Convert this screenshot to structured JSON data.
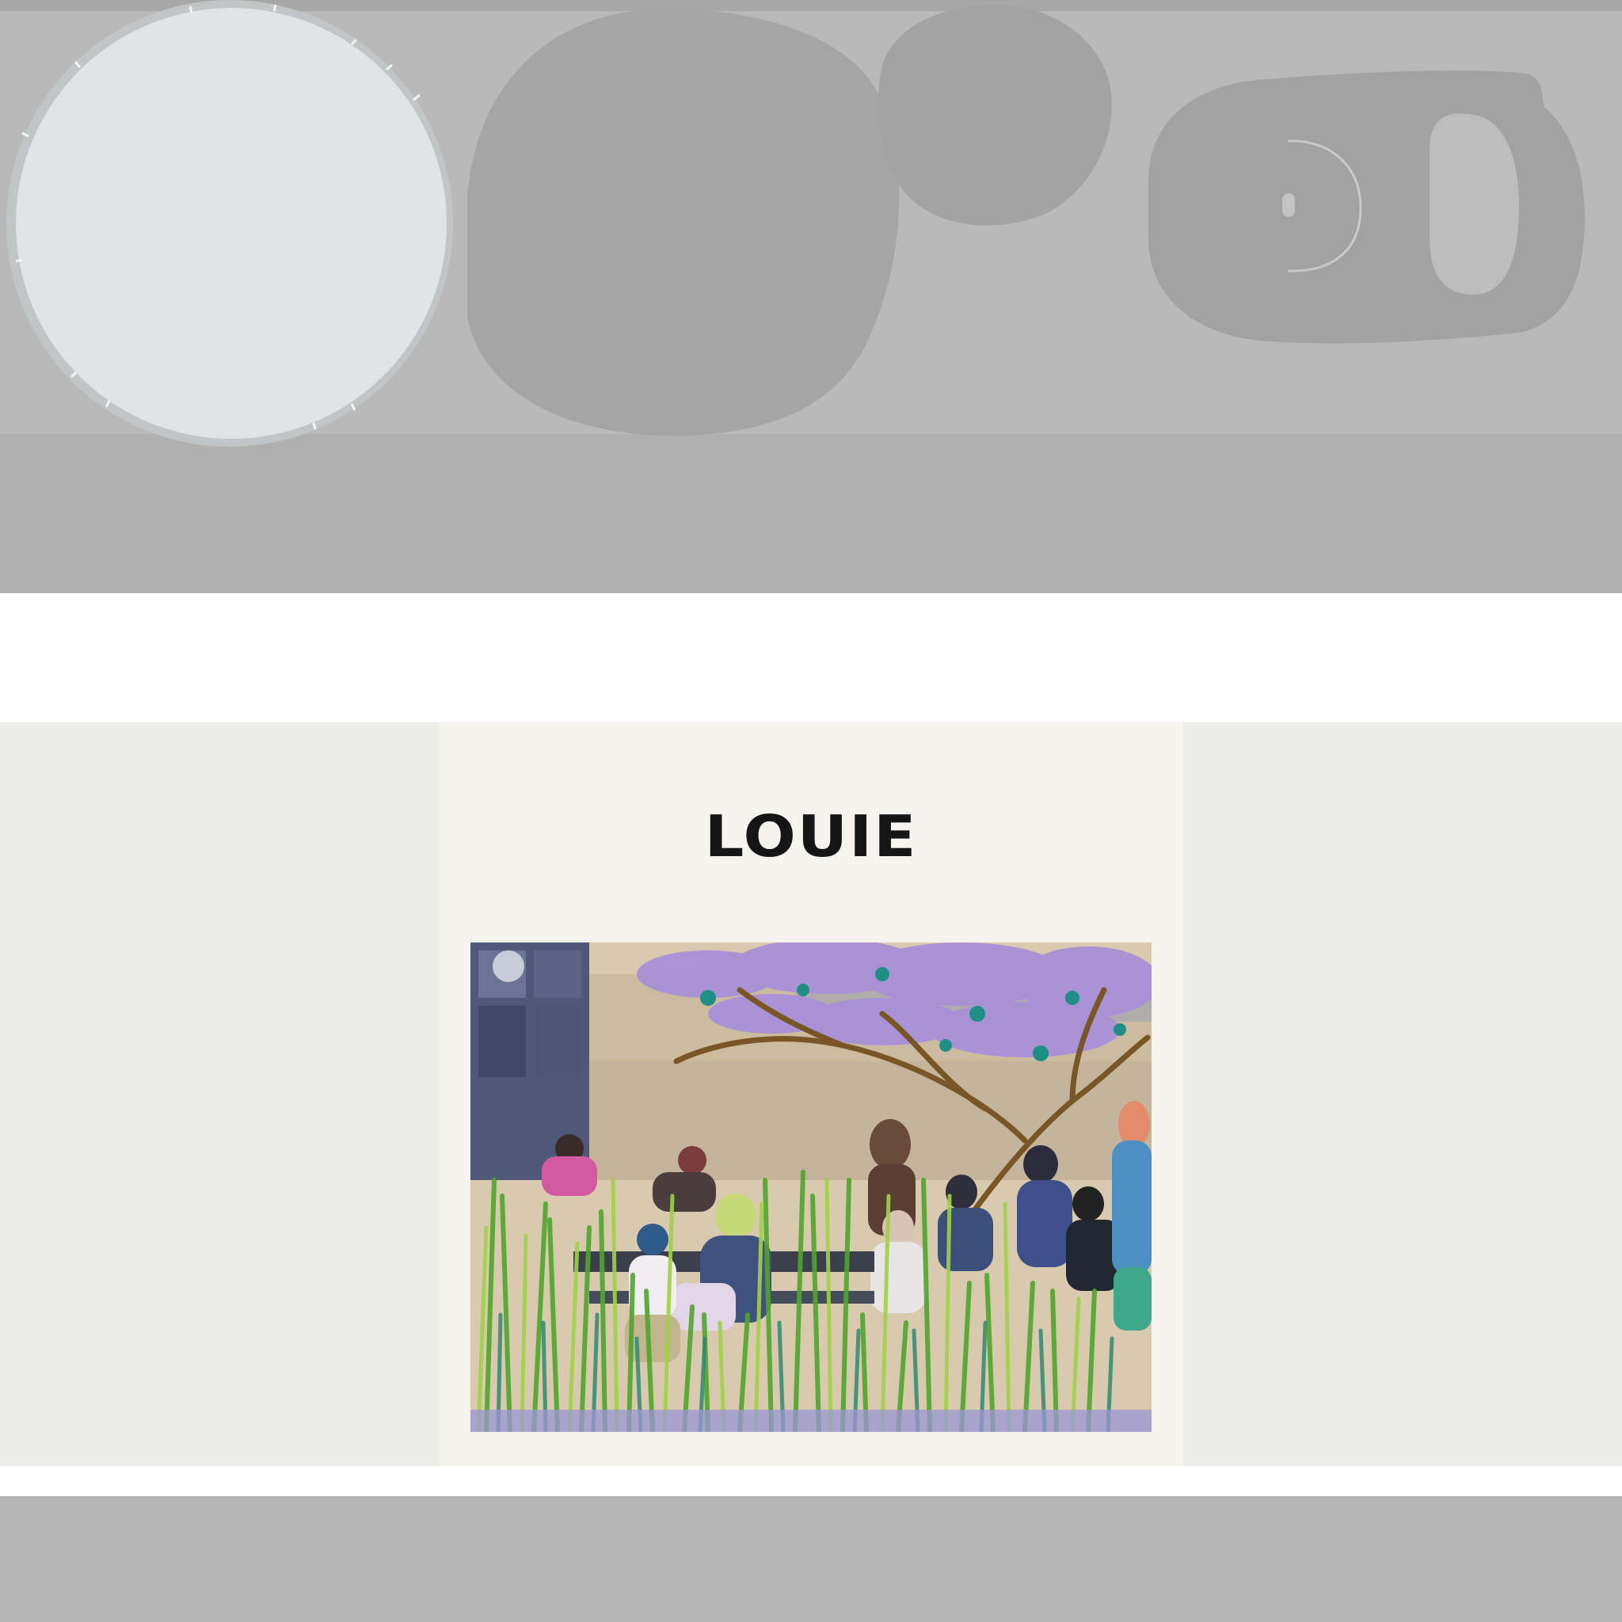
{
  "product_band": {
    "colors": {
      "background": "#b9b9b9",
      "speaker_grille": "#e1e4e4",
      "speaker_body": "#a5a5a5",
      "camera_module": "#a2a2a2"
    }
  },
  "artwork": {
    "title": "LOUIE",
    "panel_background": "#ecece8",
    "cover_background": "#f4f3ee"
  }
}
